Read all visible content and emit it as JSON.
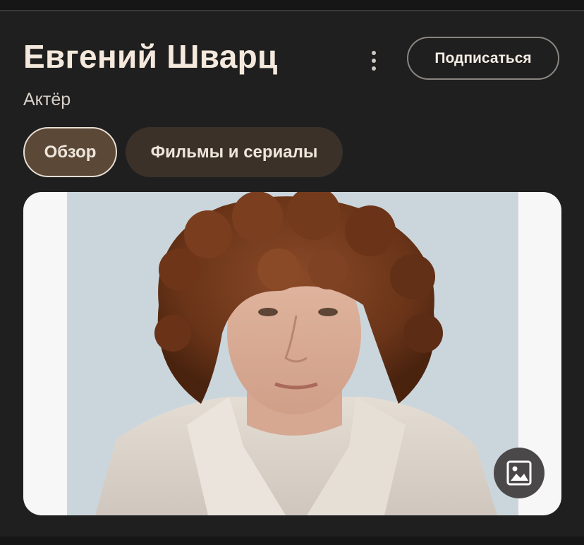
{
  "header": {
    "title": "Евгений Шварц",
    "subtitle": "Актёр",
    "subscribe_label": "Подписаться"
  },
  "tabs": [
    {
      "label": "Обзор",
      "selected": true
    },
    {
      "label": "Фильмы и сериалы",
      "selected": false
    }
  ],
  "photo": {
    "icon": "image-icon"
  },
  "colors": {
    "background": "#1f1f1f",
    "title": "#f4e9dc",
    "chip_selected_bg": "#5b4837",
    "chip_bg": "#3b3129",
    "subscribe_border": "#8a8580"
  }
}
